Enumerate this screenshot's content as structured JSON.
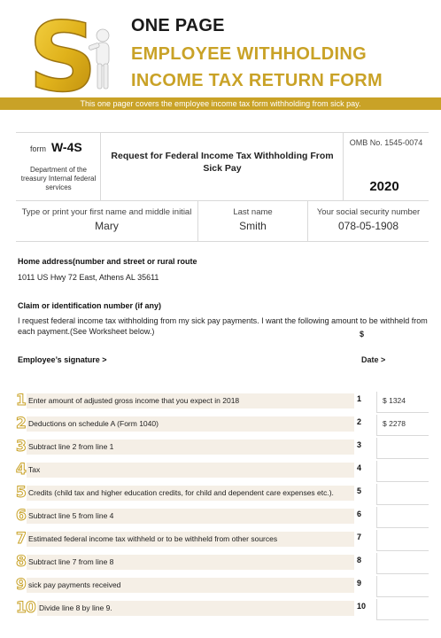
{
  "header": {
    "title_line1": "ONE PAGE",
    "title_line2": "EMPLOYEE WITHHOLDING",
    "title_line3": "INCOME TAX RETURN FORM",
    "subtitle": "This one pager covers the employee income tax form withholding from sick pay.",
    "accent_color": "#c9a227"
  },
  "form": {
    "form_word": "form",
    "form_number": "W-4S",
    "department": "Department of the treasury Internal federal services",
    "request_title": "Request for Federal Income Tax Withholding From Sick Pay",
    "omb": "OMB No. 1545-0074",
    "year": "2020"
  },
  "name_fields": {
    "first_name_label": "Type or print your first name and middle initial",
    "first_name_value": "Mary",
    "last_name_label": "Last name",
    "last_name_value": "Smith",
    "ssn_label": "Your social security number",
    "ssn_value": "078-05-1908"
  },
  "address": {
    "label": "Home address(number  and street or rural route",
    "value": "1011 US Hwy 72 East, Athens AL 35611"
  },
  "claim": {
    "label": "Claim or identification number (if any)",
    "text": "I request federal income tax withholding from my sick pay payments. I want the following amount to be withheld from each payment.(See Worksheet below.)",
    "dollar": "$"
  },
  "signature": {
    "label": "Employee’s signature >",
    "date_label": "Date >"
  },
  "lines": [
    {
      "digit": "1",
      "text": "Enter amount of adjusted gross income that you expect in 2018",
      "no": "1",
      "value": "$ 1324"
    },
    {
      "digit": "2",
      "text": "Deductions on schedule A (Form 1040)",
      "no": "2",
      "value": "$ 2278"
    },
    {
      "digit": "3",
      "text": "Subtract line 2 from line 1",
      "no": "3",
      "value": ""
    },
    {
      "digit": "4",
      "text": "Tax",
      "no": "4",
      "value": ""
    },
    {
      "digit": "5",
      "text": "Credits (child tax and higher education credits, for child and dependent care expenses etc.).",
      "no": "5",
      "value": ""
    },
    {
      "digit": "6",
      "text": "Subtract line 5 from line 4",
      "no": "6",
      "value": ""
    },
    {
      "digit": "7",
      "text": "Estimated federal income tax withheld or to be withheld from other sources",
      "no": "7",
      "value": ""
    },
    {
      "digit": "8",
      "text": "Subtract line 7 from line 8",
      "no": "8",
      "value": ""
    },
    {
      "digit": "9",
      "text": "sick pay payments received",
      "no": "9",
      "value": ""
    },
    {
      "digit": "10",
      "text": "Divide line 8 by line 9.",
      "no": "10",
      "value": ""
    }
  ]
}
